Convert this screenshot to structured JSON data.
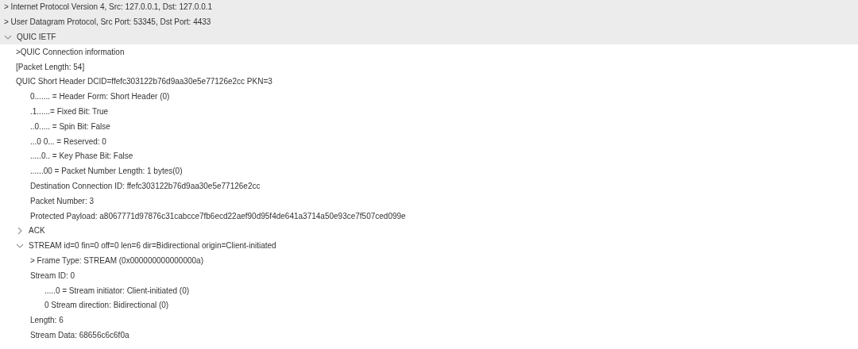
{
  "tree": [
    {
      "kind": "layer",
      "text": "> Internet Protocol Version 4,  Src: 127.0.0.1, Dst: 127.0.0.1"
    },
    {
      "kind": "layer",
      "text": "> User Datagram Protocol,  Src Port: 53345, Dst Port: 4433"
    },
    {
      "kind": "layer",
      "text": "QUIC IETF",
      "expanded": true,
      "children": [
        {
          "kind": "field",
          "text": ">QUIC Connection information"
        },
        {
          "kind": "field",
          "text": "[Packet Length: 54]"
        },
        {
          "kind": "field",
          "text": "QUIC Short Header DCID=ffefc303122b76d9aa30e5e77126e2cc PKN=3",
          "children": [
            {
              "kind": "field",
              "text": "0....... = Header Form:  Short Header (0)"
            },
            {
              "kind": "field",
              "text": ".1......= Fixed Bit:  True"
            },
            {
              "kind": "field",
              "text": "..0..... = Spin Bit:  False"
            },
            {
              "kind": "field",
              "text": "...0 0... = Reserved:  0"
            },
            {
              "kind": "field",
              "text": ".....0.. = Key Phase Bit:  False"
            },
            {
              "kind": "field",
              "text": "......00 = Packet Number Length:  1 bytes(0)"
            },
            {
              "kind": "field",
              "text": "Destination Connection ID: ffefc303122b76d9aa30e5e77126e2cc"
            },
            {
              "kind": "field",
              "text": "Packet Number: 3"
            },
            {
              "kind": "field",
              "text": "Protected Payload: a8067771d97876c31cabcce7fb6ecd22aef90d95f4de641a3714a50e93ce7f507ced099e"
            }
          ]
        },
        {
          "kind": "field",
          "text": "ACK",
          "expanded": false
        },
        {
          "kind": "field",
          "text": "STREAM id=0 fin=0 off=0 len=6 dir=Bidirectional origin=Client-initiated",
          "expanded": true,
          "children": [
            {
              "kind": "field",
              "text": "> Frame Type:  STREAM (0x000000000000000a)"
            },
            {
              "kind": "field",
              "text": "Stream ID: 0",
              "children": [
                {
                  "kind": "field",
                  "text": ".....0 = Stream initiator:  Client-initiated (0)"
                },
                {
                  "kind": "field",
                  "text": "0 Stream direction: Bidirectional (0)"
                }
              ]
            },
            {
              "kind": "field",
              "text": "Length: 6"
            },
            {
              "kind": "field",
              "text": "Stream Data: 68656c6c6f0a"
            }
          ]
        }
      ]
    }
  ]
}
